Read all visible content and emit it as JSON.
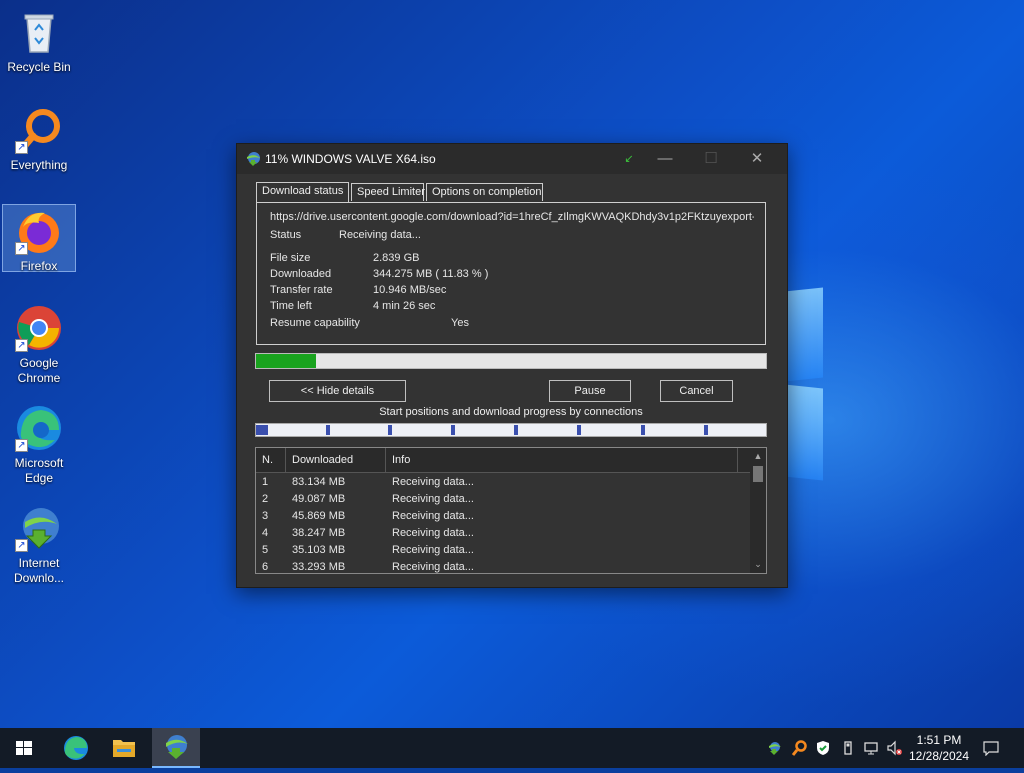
{
  "desktop": {
    "icons": [
      {
        "label": "Recycle Bin",
        "icon": "recycle-bin-icon"
      },
      {
        "label": "Everything",
        "icon": "everything-search-icon"
      },
      {
        "label": "Firefox",
        "icon": "firefox-icon"
      },
      {
        "label": "Google Chrome",
        "icon": "chrome-icon"
      },
      {
        "label": "Microsoft Edge",
        "icon": "edge-icon"
      },
      {
        "label": "Internet Downlo...",
        "icon": "idm-icon"
      }
    ]
  },
  "dialog": {
    "title": "11% WINDOWS VALVE X64.iso",
    "tabs": [
      "Download status",
      "Speed Limiter",
      "Options on completion"
    ],
    "url": "https://drive.usercontent.google.com/download?id=1hreCf_zIlmgKWVAQKDhdy3v1p2FKtzuyexport-",
    "status_label": "Status",
    "status_value": "Receiving data...",
    "file_size_label": "File size",
    "file_size_value": "2.839  GB",
    "downloaded_label": "Downloaded",
    "downloaded_value": "344.275  MB  ( 11.83 % )",
    "transfer_rate_label": "Transfer rate",
    "transfer_rate_value": "10.946  MB/sec",
    "time_left_label": "Time left",
    "time_left_value": "4 min 26 sec",
    "resume_label": "Resume capability",
    "resume_value": "Yes",
    "progress_fraction": 0.1183,
    "hide_details_label": "<< Hide details",
    "pause_label": "Pause",
    "cancel_label": "Cancel",
    "connections_label": "Start positions and download progress by connections",
    "table": {
      "headers": [
        "N.",
        "Downloaded",
        "Info"
      ],
      "rows": [
        [
          "1",
          "83.134  MB",
          "Receiving data..."
        ],
        [
          "2",
          "49.087  MB",
          "Receiving data..."
        ],
        [
          "3",
          "45.869  MB",
          "Receiving data..."
        ],
        [
          "4",
          "38.247  MB",
          "Receiving data..."
        ],
        [
          "5",
          "35.103  MB",
          "Receiving data..."
        ],
        [
          "6",
          "33.293  MB",
          "Receiving data..."
        ]
      ]
    }
  },
  "taskbar": {
    "time": "1:51 PM",
    "date": "12/28/2024"
  },
  "colors": {
    "progress": "#19a31e",
    "dialog_bg": "#333333",
    "taskbar_bg": "#131b26"
  }
}
